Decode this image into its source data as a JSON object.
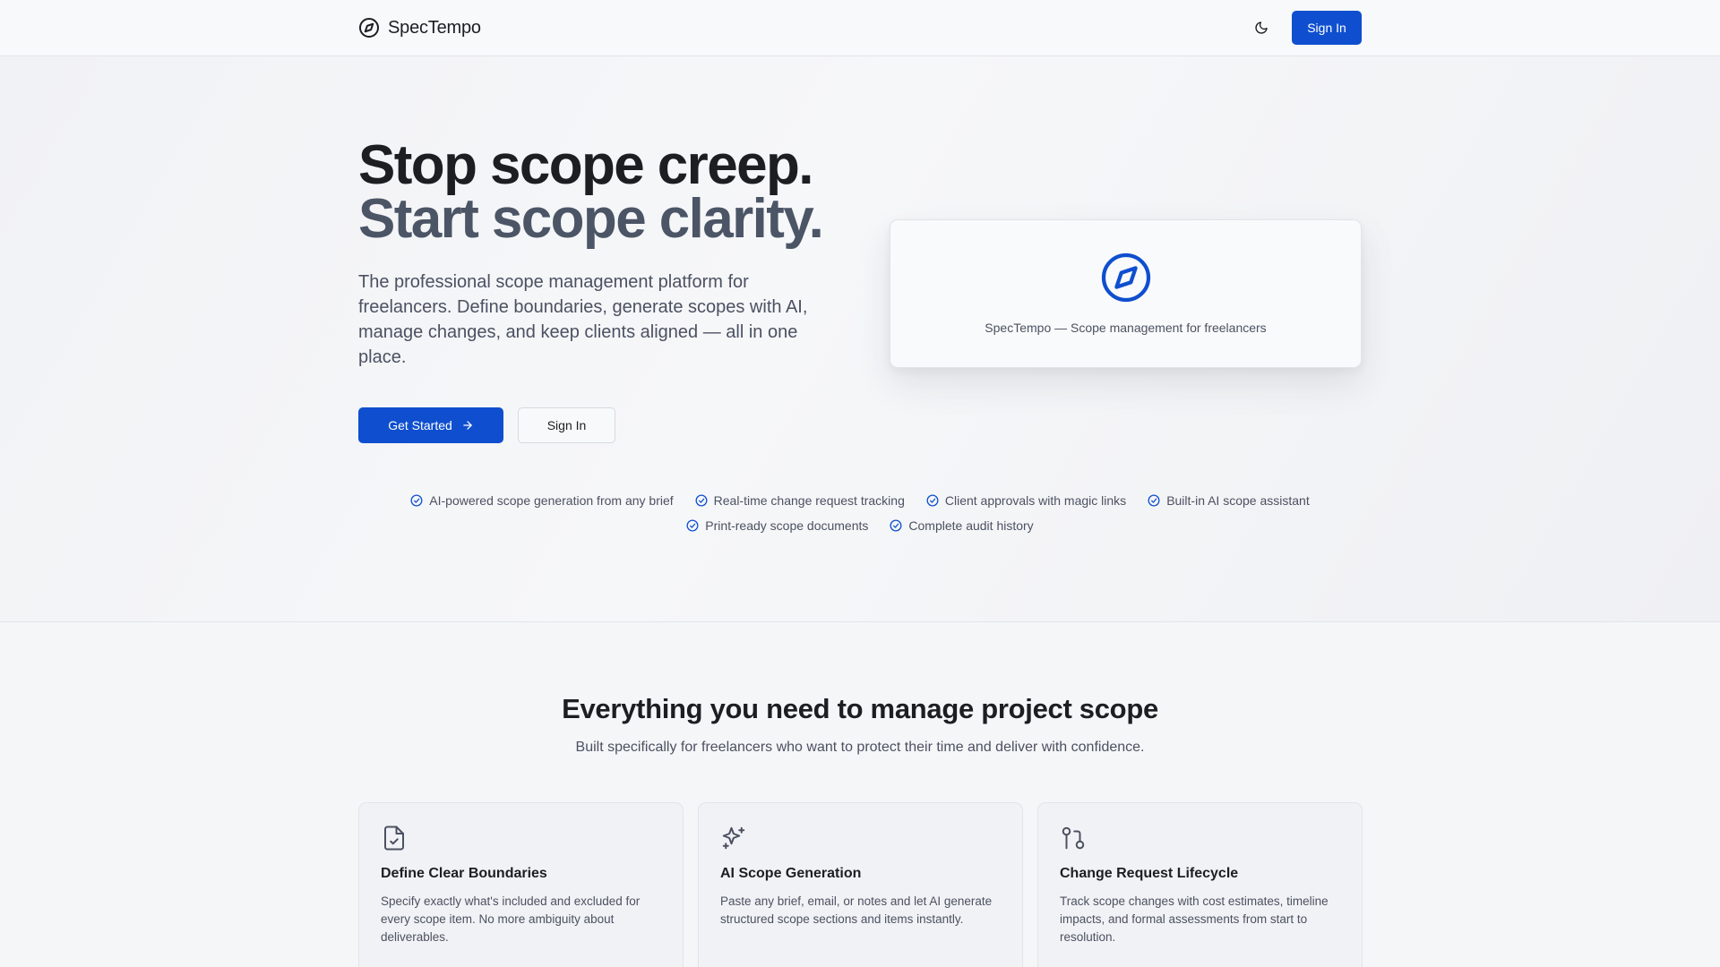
{
  "header": {
    "brand_name": "SpecTempo",
    "brand_icon": "compass-icon",
    "theme_icon": "moon-icon",
    "sign_in_label": "Sign In"
  },
  "hero": {
    "title_line1": "Stop scope creep.",
    "title_line2": "Start scope clarity.",
    "description": "The professional scope management platform for freelancers. Define boundaries, generate scopes with AI, manage changes, and keep clients aligned — all in one place.",
    "get_started_label": "Get Started",
    "get_started_icon": "arrow-right-icon",
    "sign_in_label": "Sign In",
    "preview_caption": "SpecTempo — Scope management for freelancers",
    "features": [
      "AI-powered scope generation from any brief",
      "Real-time change request tracking",
      "Client approvals with magic links",
      "Built-in AI scope assistant",
      "Print-ready scope documents",
      "Complete audit history"
    ]
  },
  "section": {
    "title": "Everything you need to manage project scope",
    "subtitle": "Built specifically for freelancers who want to protect their time and deliver with confidence.",
    "cards": [
      {
        "icon": "file-check-icon",
        "title": "Define Clear Boundaries",
        "description": "Specify exactly what's included and excluded for every scope item. No more ambiguity about deliverables."
      },
      {
        "icon": "sparkles-icon",
        "title": "AI Scope Generation",
        "description": "Paste any brief, email, or notes and let AI generate structured scope sections and items instantly."
      },
      {
        "icon": "git-pull-request-icon",
        "title": "Change Request Lifecycle",
        "description": "Track scope changes with cost estimates, timeline impacts, and formal assessments from start to resolution."
      }
    ]
  },
  "colors": {
    "accent": "#0f4fcf",
    "text_primary": "#1c1e22",
    "text_secondary": "#4b5161",
    "title_secondary": "#4b5566"
  }
}
